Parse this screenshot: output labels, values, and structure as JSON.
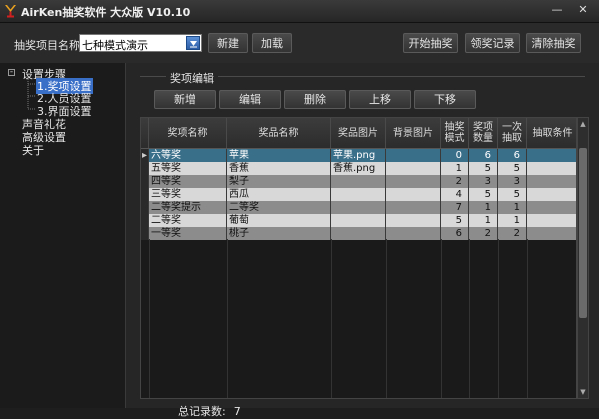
{
  "window": {
    "title": "AirKen抽奖软件 大众版 V10.10",
    "min_glyph": "—",
    "close_glyph": "✕"
  },
  "toolbar": {
    "project_label": "抽奖项目名称",
    "project_value": "七种模式演示",
    "new_label": "新建",
    "load_label": "加载",
    "start_label": "开始抽奖",
    "claim_label": "领奖记录",
    "clear_label": "清除抽奖"
  },
  "sidebar": {
    "root": "设置步骤",
    "children": [
      "1.奖项设置",
      "2.人员设置",
      "3.界面设置"
    ],
    "items": [
      "声音礼花",
      "高级设置",
      "关于"
    ],
    "toggle": "-"
  },
  "editor": {
    "section_title": "奖项编辑",
    "buttons": [
      "新增",
      "编辑",
      "删除",
      "上移",
      "下移"
    ]
  },
  "table": {
    "columns": [
      "奖项名称",
      "奖品名称",
      "奖品图片",
      "背景图片",
      "抽奖模式",
      "奖项数量",
      "一次抽取",
      "抽取条件"
    ],
    "rows": [
      [
        "六等奖",
        "苹果",
        "苹果.png",
        "",
        "0",
        "6",
        "6",
        ""
      ],
      [
        "五等奖",
        "香蕉",
        "香蕉.png",
        "",
        "1",
        "5",
        "5",
        ""
      ],
      [
        "四等奖",
        "梨子",
        "",
        "",
        "2",
        "3",
        "3",
        ""
      ],
      [
        "三等奖",
        "西瓜",
        "",
        "",
        "4",
        "5",
        "5",
        ""
      ],
      [
        "二等奖提示",
        "二等奖",
        "",
        "",
        "7",
        "1",
        "1",
        ""
      ],
      [
        "二等奖",
        "葡萄",
        "",
        "",
        "5",
        "1",
        "1",
        ""
      ],
      [
        "一等奖",
        "桃子",
        "",
        "",
        "6",
        "2",
        "2",
        ""
      ]
    ],
    "current_row_marker": "▸"
  },
  "footer": {
    "total_label": "总记录数:",
    "total_value": "7"
  },
  "colors": {
    "selected_row": "#3a6f8a",
    "odd_row": "#d8d8d8",
    "even_row": "#8c8c8c",
    "tree_selected": "#3a6fc8"
  }
}
